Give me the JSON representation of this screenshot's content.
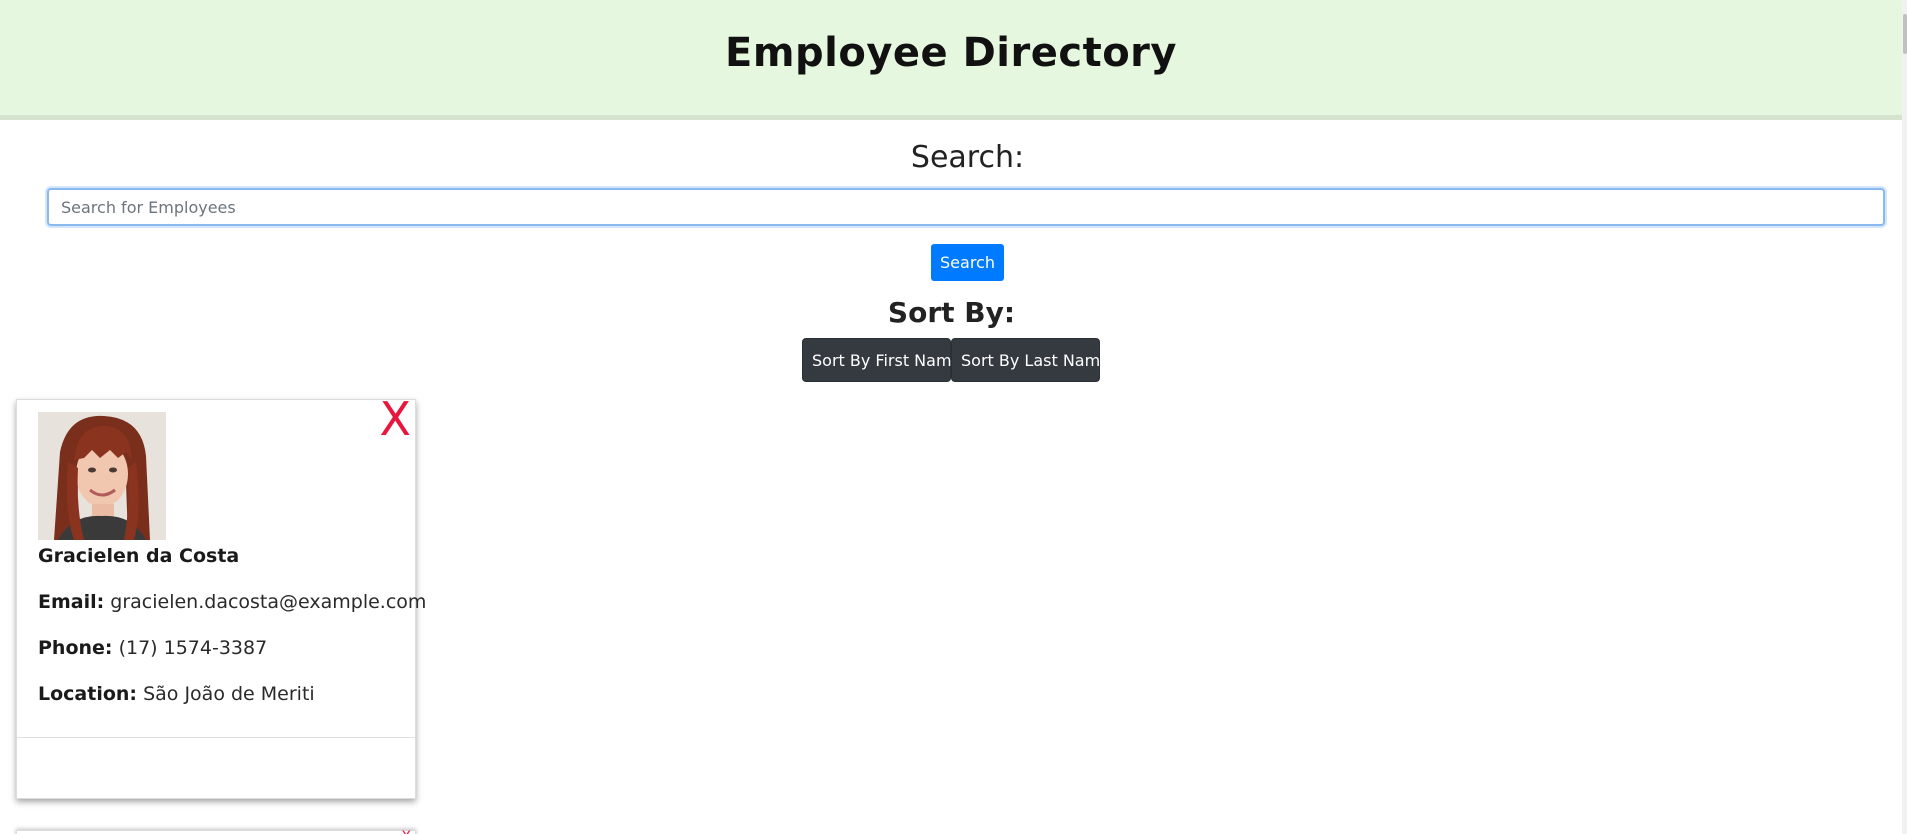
{
  "header": {
    "title": "Employee Directory"
  },
  "search": {
    "label": "Search:",
    "placeholder": "Search for Employees",
    "value": "",
    "button_label": "Search"
  },
  "sort": {
    "label": "Sort By:",
    "first_name_label": "Sort By First Name",
    "last_name_label": "Sort By Last Name"
  },
  "employees": [
    {
      "name": "Gracielen da Costa",
      "email_label": "Email:",
      "email": "gracielen.dacosta@example.com",
      "phone_label": "Phone:",
      "phone": "(17) 1574-3387",
      "location_label": "Location:",
      "location": "São João de Meriti",
      "remove_label": "X"
    },
    {
      "remove_label": "X"
    }
  ],
  "colors": {
    "header_bg": "#e6f7df",
    "primary_button": "#007bff",
    "dark_button": "#343a40",
    "remove_x": "#e8163c"
  }
}
